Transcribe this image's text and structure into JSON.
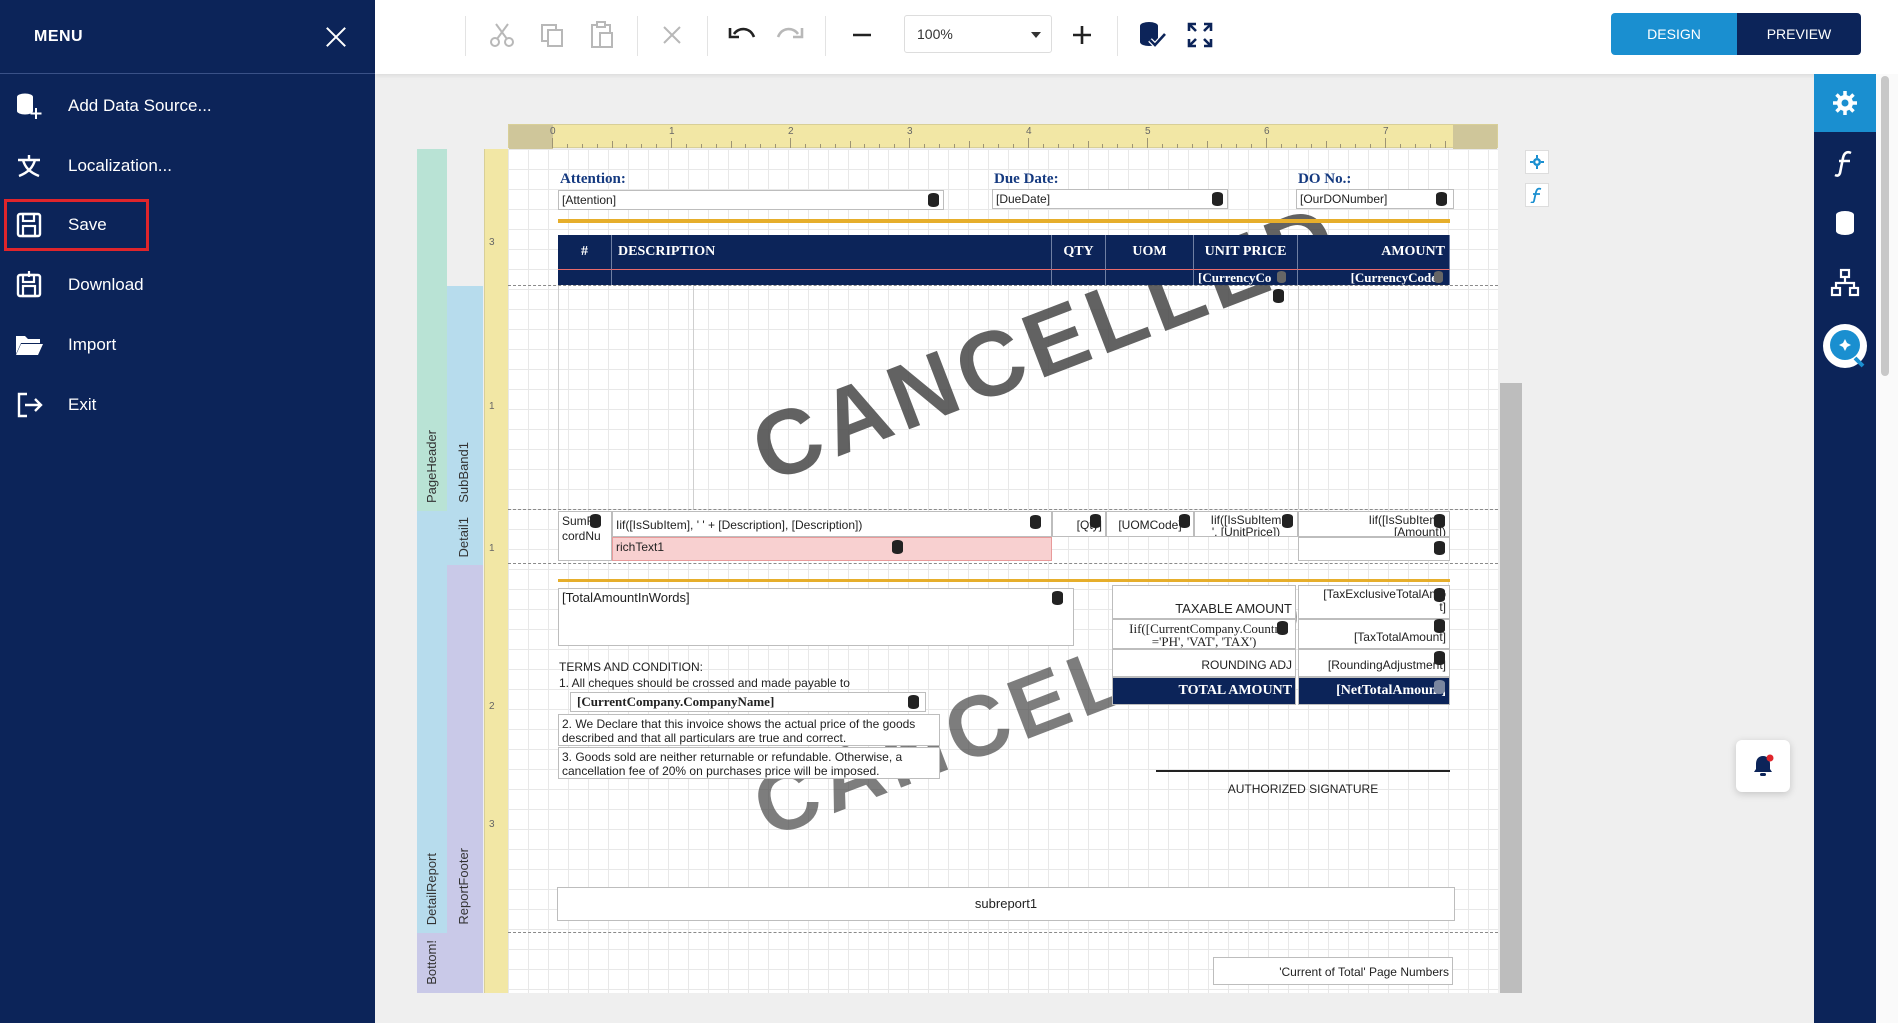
{
  "menu": {
    "title": "MENU",
    "items": [
      {
        "label": "Add Data Source...",
        "icon": "add-database-icon"
      },
      {
        "label": "Localization...",
        "icon": "localization-icon"
      },
      {
        "label": "Save",
        "icon": "save-icon",
        "selected": true
      },
      {
        "label": "Download",
        "icon": "download-icon"
      },
      {
        "label": "Import",
        "icon": "folder-open-icon"
      },
      {
        "label": "Exit",
        "icon": "exit-icon"
      }
    ]
  },
  "toolbar": {
    "zoom": "100%",
    "design_label": "DESIGN",
    "preview_label": "PREVIEW",
    "icons": [
      "cut-icon",
      "copy-icon",
      "paste-icon",
      "delete-icon",
      "undo-icon",
      "redo-icon",
      "zoom-out-icon",
      "zoom-in-icon",
      "validate-bindings-icon",
      "fullscreen-icon"
    ]
  },
  "rail": {
    "icons": [
      "settings-icon",
      "expressions-icon",
      "field-list-icon",
      "report-explorer-icon",
      "ai-assistant-icon"
    ]
  },
  "ruler": {
    "h_numbers": [
      "0",
      "1",
      "2",
      "3",
      "4",
      "5",
      "6",
      "7"
    ],
    "v_numbers": [
      "3",
      "1",
      "1",
      "2",
      "3"
    ]
  },
  "bands": {
    "page_header": "PageHeader",
    "subband": "SubBand1",
    "detail": "Detail1",
    "detail_report": "DetailReport",
    "report_footer": "ReportFooter",
    "bottom": "Bottom!"
  },
  "header": {
    "attention_label": "Attention:",
    "attention_value": "[Attention]",
    "due_label": "Due Date:",
    "due_value": "[DueDate]",
    "do_label": "DO No.:",
    "do_value": "[OurDONumber]"
  },
  "table": {
    "headers": [
      "#",
      "DESCRIPTION",
      "QTY",
      "UOM",
      "UNIT PRICE",
      "AMOUNT"
    ],
    "currency_unit": "[CurrencyCo",
    "currency_amount": "[CurrencyCode"
  },
  "detail": {
    "sum_top": "SumR",
    "sum_bottom": "cordNu",
    "desc_expr": "Iif([IsSubItem], '    ' + [Description], [Description])",
    "qty": "[Qty]",
    "uom": "[UOMCode]",
    "unit_top": "Iif([IsSubItem",
    "unit_bottom": "', [UnitPrice])",
    "amount_top": "Iif([IsSubItem],",
    "amount_bottom": "[Amount])",
    "rich_text": "richText1"
  },
  "footer": {
    "amount_words": "[TotalAmountInWords]",
    "terms_title": "TERMS AND CONDITION:",
    "term1": "1. All cheques should be crossed and made payable to",
    "company": "[CurrentCompany.CompanyName]",
    "term2a": "2. We Declare that this invoice shows the actual price of the goods",
    "term2b": "described and that all particulars are true and correct.",
    "term3a": "3. Goods sold are neither returnable or refundable. Otherwise, a",
    "term3b": "cancellation fee of 20% on purchases price will be imposed.",
    "taxable_label": "TAXABLE AMOUNT",
    "taxable_value": "[TaxExclusiveTotalAmo",
    "taxable_value_b": "t]",
    "tax_expr_a": "Iif([CurrentCompany.Countr",
    "tax_expr_b": "='PH', 'VAT', 'TAX')",
    "tax_value": "[TaxTotalAmount]",
    "rounding_label": "ROUNDING ADJ",
    "rounding_value": "[RoundingAdjustment]",
    "total_label": "TOTAL AMOUNT",
    "total_value": "[NetTotalAmount]",
    "signature": "AUTHORIZED SIGNATURE",
    "subreport": "subreport1",
    "page_numbers": "'Current of Total' Page Numbers"
  },
  "watermark": "CANCELLED",
  "colors": {
    "menu_bg": "#0c2459",
    "accent": "#1a8fd0",
    "gold_line": "#e6ae2b",
    "selection": "#e0252b"
  }
}
